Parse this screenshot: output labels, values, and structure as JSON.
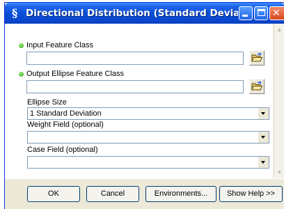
{
  "window": {
    "title": "Directional Distribution (Standard Deviation...",
    "icon": "script-s-icon",
    "controls": {
      "minimize_icon": "minimize-icon",
      "maximize_icon": "maximize-icon",
      "close_icon": "close-icon"
    }
  },
  "params": {
    "input_feature_class": {
      "label": "Input Feature Class",
      "value": "",
      "required": true
    },
    "output_ellipse_feature_class": {
      "label": "Output Ellipse Feature Class",
      "value": "",
      "required": true
    },
    "ellipse_size": {
      "label": "Ellipse Size",
      "value": "1 Standard Deviation"
    },
    "weight_field": {
      "label": "Weight Field (optional)",
      "value": ""
    },
    "case_field": {
      "label": "Case Field (optional)",
      "value": ""
    }
  },
  "buttons": {
    "ok": "OK",
    "cancel": "Cancel",
    "environments": "Environments...",
    "show_help": "Show Help >>"
  },
  "colors": {
    "titlebar": "#0a4fd8",
    "required_dot": "#2e9a1a",
    "dialog_bg": "#ece9d8"
  }
}
